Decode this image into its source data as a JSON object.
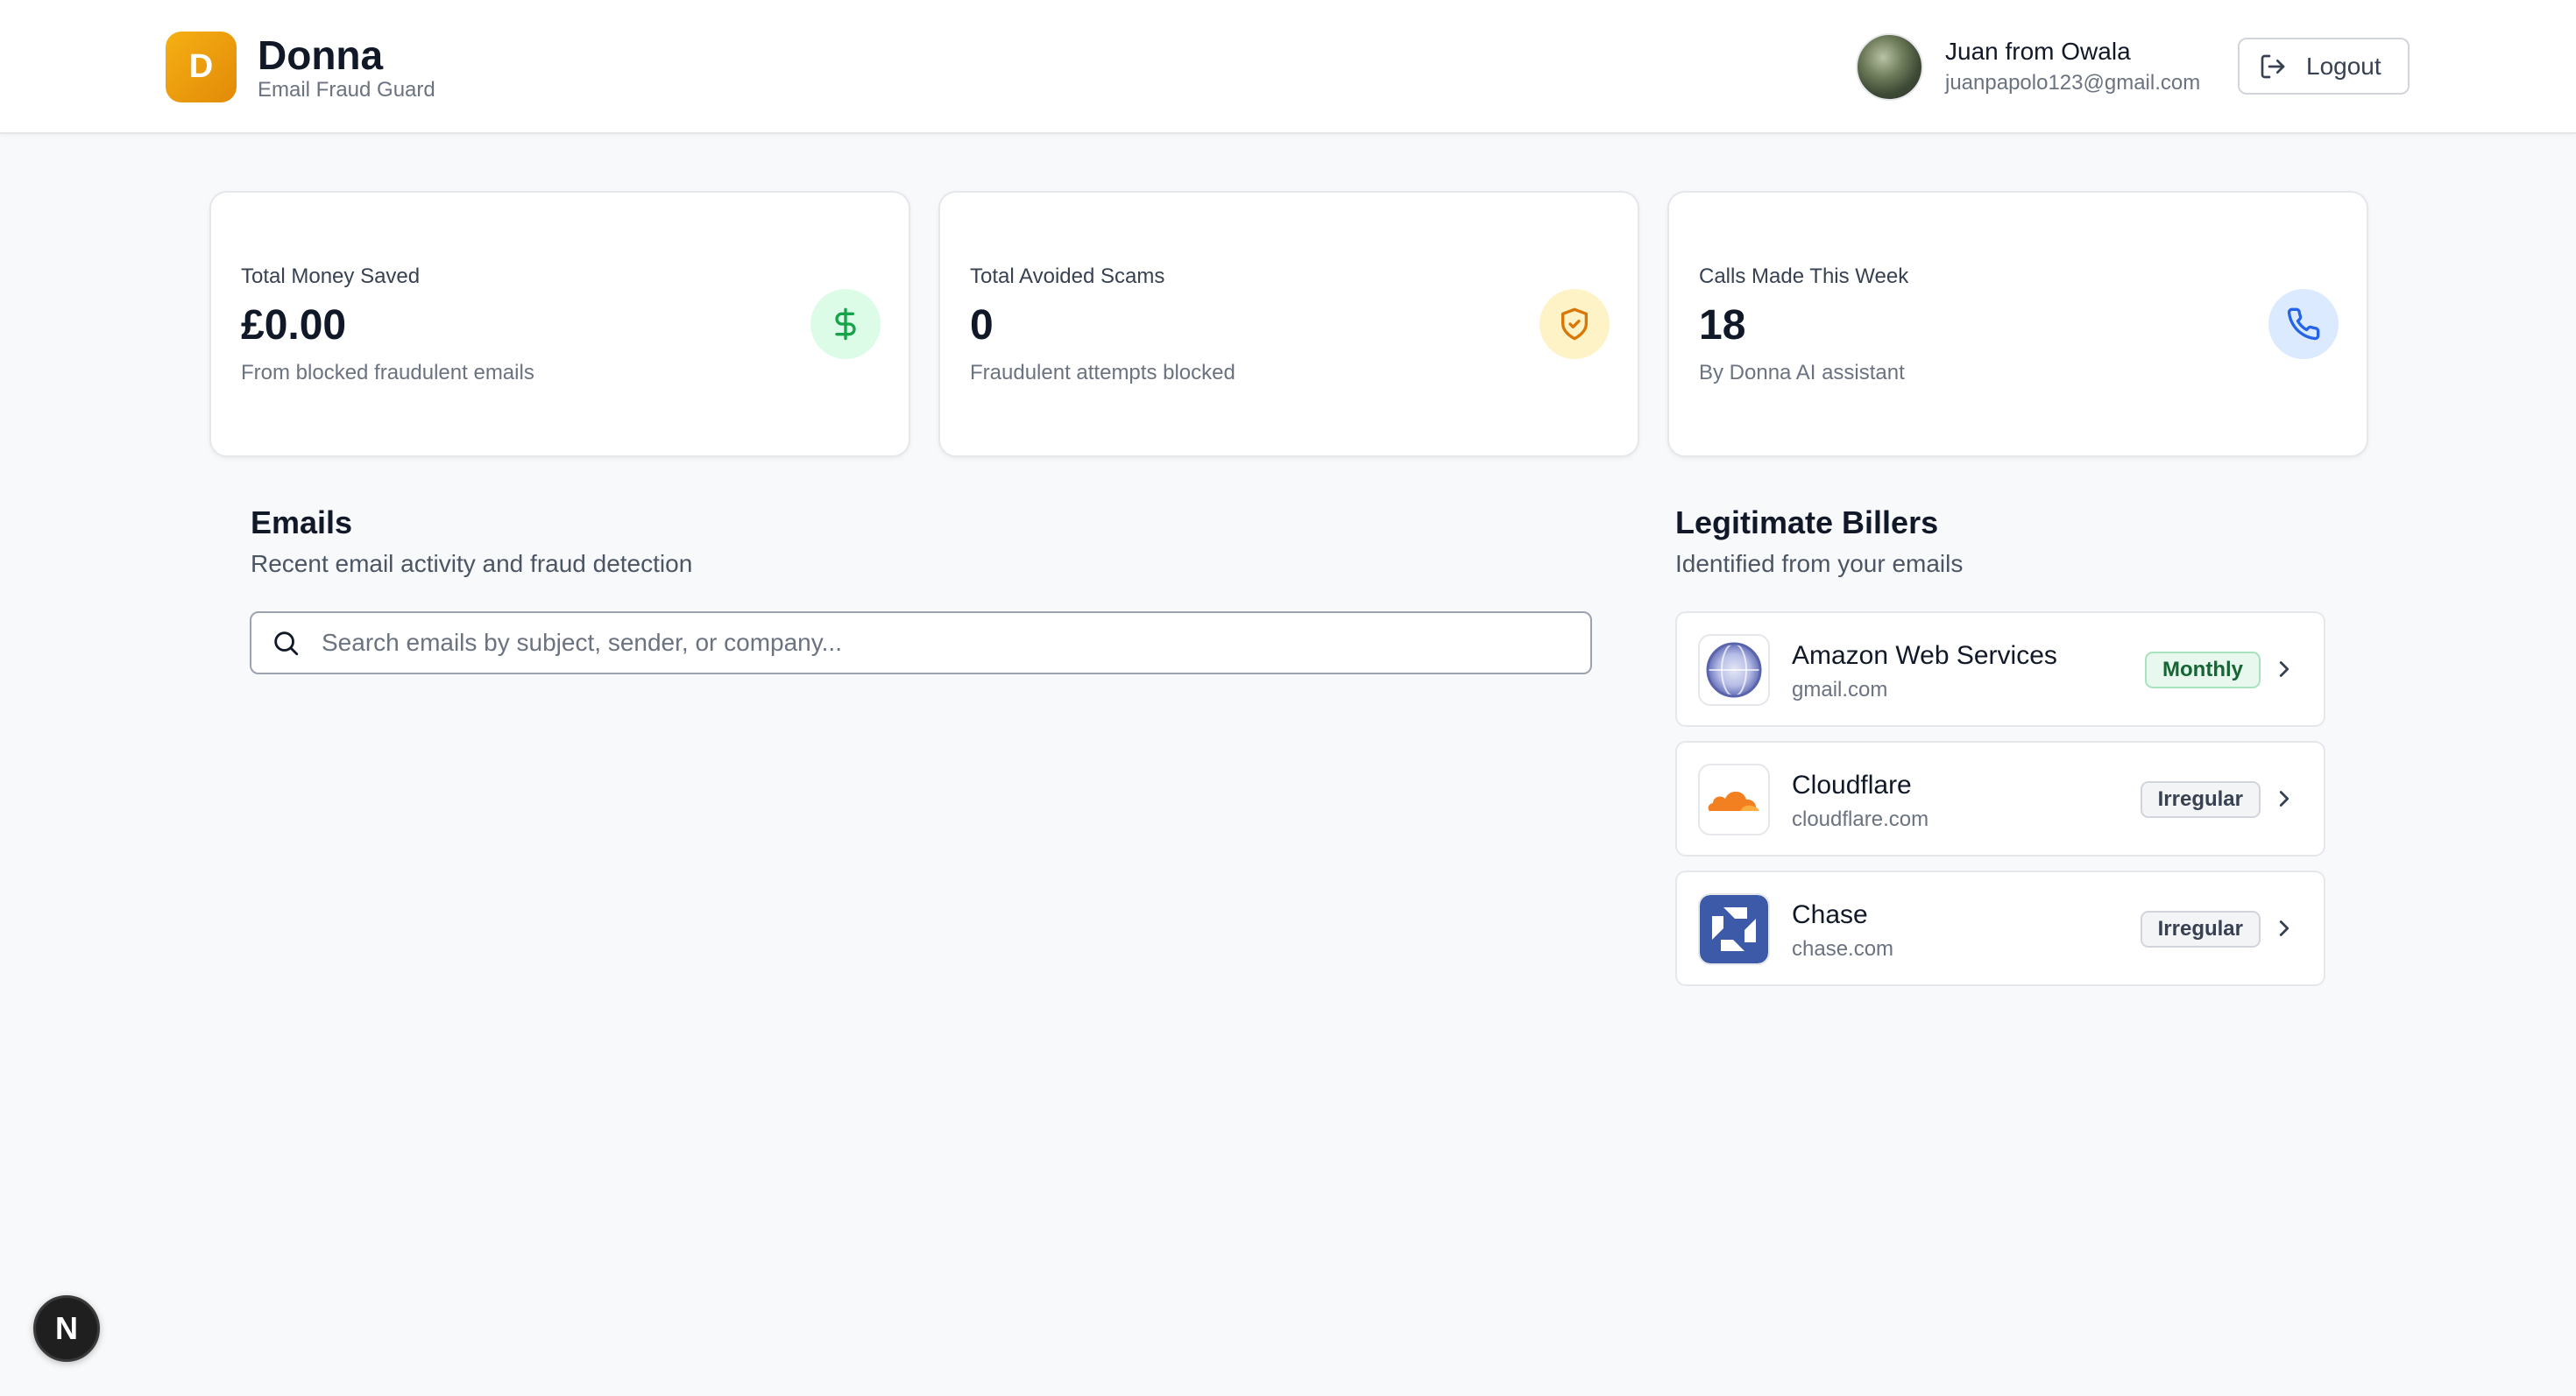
{
  "app": {
    "logo_letter": "D",
    "name": "Donna",
    "tagline": "Email Fraud Guard"
  },
  "user": {
    "name": "Juan from Owala",
    "email": "juanpapolo123@gmail.com"
  },
  "header": {
    "logout_label": "Logout"
  },
  "stats": [
    {
      "label": "Total Money Saved",
      "value": "£0.00",
      "desc": "From blocked fraudulent emails",
      "icon": "dollar-icon",
      "icon_bg": "#dcfce7",
      "icon_color": "#16a34a"
    },
    {
      "label": "Total Avoided Scams",
      "value": "0",
      "desc": "Fraudulent attempts blocked",
      "icon": "shield-check-icon",
      "icon_bg": "#fef3c7",
      "icon_color": "#d97706"
    },
    {
      "label": "Calls Made This Week",
      "value": "18",
      "desc": "By Donna AI assistant",
      "icon": "phone-icon",
      "icon_bg": "#dbeafe",
      "icon_color": "#2563eb"
    }
  ],
  "emails": {
    "title": "Emails",
    "subtitle": "Recent email activity and fraud detection",
    "search_placeholder": "Search emails by subject, sender, or company..."
  },
  "billers": {
    "title": "Legitimate Billers",
    "subtitle": "Identified from your emails",
    "items": [
      {
        "name": "Amazon Web Services",
        "domain": "gmail.com",
        "frequency": "Monthly",
        "logo": "globe-icon"
      },
      {
        "name": "Cloudflare",
        "domain": "cloudflare.com",
        "frequency": "Irregular",
        "logo": "cloudflare-logo"
      },
      {
        "name": "Chase",
        "domain": "chase.com",
        "frequency": "Irregular",
        "logo": "chase-logo"
      }
    ]
  },
  "dev_badge": {
    "letter": "N"
  }
}
